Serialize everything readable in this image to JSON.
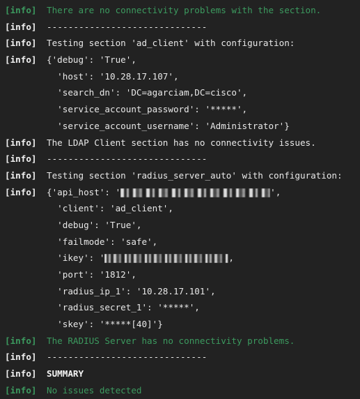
{
  "terminal": {
    "background_color": "#222222",
    "text_color": "#e8e8e8",
    "green_color": "#3c9a5f",
    "lines": [
      {
        "tag": "[info]",
        "tag_style": "green",
        "text": "There are no connectivity problems with the section.",
        "style": "green"
      },
      {
        "tag": "[info]",
        "tag_style": "white",
        "text": "------------------------------",
        "style": "white"
      },
      {
        "tag": "[info]",
        "tag_style": "white",
        "text": "Testing section 'ad_client' with configuration:",
        "style": "white"
      },
      {
        "tag": "[info]",
        "tag_style": "white",
        "text": "{'debug': 'True',",
        "style": "white"
      },
      {
        "tag": "",
        "tag_style": "none",
        "text": "  'host': '10.28.17.107',",
        "style": "white"
      },
      {
        "tag": "",
        "tag_style": "none",
        "text": "  'search_dn': 'DC=agarciam,DC=cisco',",
        "style": "white"
      },
      {
        "tag": "",
        "tag_style": "none",
        "text": "  'service_account_password': '*****',",
        "style": "white"
      },
      {
        "tag": "",
        "tag_style": "none",
        "text": "  'service_account_username': 'Administrator'}",
        "style": "white"
      },
      {
        "tag": "[info]",
        "tag_style": "white",
        "text": "The LDAP Client section has no connectivity issues.",
        "style": "white"
      },
      {
        "tag": "[info]",
        "tag_style": "white",
        "text": "------------------------------",
        "style": "white"
      },
      {
        "tag": "[info]",
        "tag_style": "white",
        "text": "Testing section 'radius_server_auto' with configuration:",
        "style": "white"
      },
      {
        "tag": "[info]",
        "tag_style": "white",
        "text": "{'api_host': '",
        "style": "white",
        "redacted": "api-host",
        "redacted_width": 215,
        "text_after": "',"
      },
      {
        "tag": "",
        "tag_style": "none",
        "text": "  'client': 'ad_client',",
        "style": "white"
      },
      {
        "tag": "",
        "tag_style": "none",
        "text": "  'debug': 'True',",
        "style": "white"
      },
      {
        "tag": "",
        "tag_style": "none",
        "text": "  'failmode': 'safe',",
        "style": "white"
      },
      {
        "tag": "",
        "tag_style": "none",
        "text": "  'ikey': '",
        "style": "white",
        "redacted": "ikey",
        "redacted_width": 178,
        "text_after": ","
      },
      {
        "tag": "",
        "tag_style": "none",
        "text": "  'port': '1812',",
        "style": "white"
      },
      {
        "tag": "",
        "tag_style": "none",
        "text": "  'radius_ip_1': '10.28.17.101',",
        "style": "white"
      },
      {
        "tag": "",
        "tag_style": "none",
        "text": "  'radius_secret_1': '*****',",
        "style": "white"
      },
      {
        "tag": "",
        "tag_style": "none",
        "text": "  'skey': '*****[40]'}",
        "style": "white"
      },
      {
        "tag": "[info]",
        "tag_style": "green",
        "text": "The RADIUS Server has no connectivity problems.",
        "style": "green"
      },
      {
        "tag": "[info]",
        "tag_style": "white",
        "text": "------------------------------",
        "style": "white"
      },
      {
        "tag": "[info]",
        "tag_style": "white",
        "text": "SUMMARY",
        "style": "bold"
      },
      {
        "tag": "[info]",
        "tag_style": "green",
        "text": "No issues detected",
        "style": "green"
      }
    ]
  }
}
